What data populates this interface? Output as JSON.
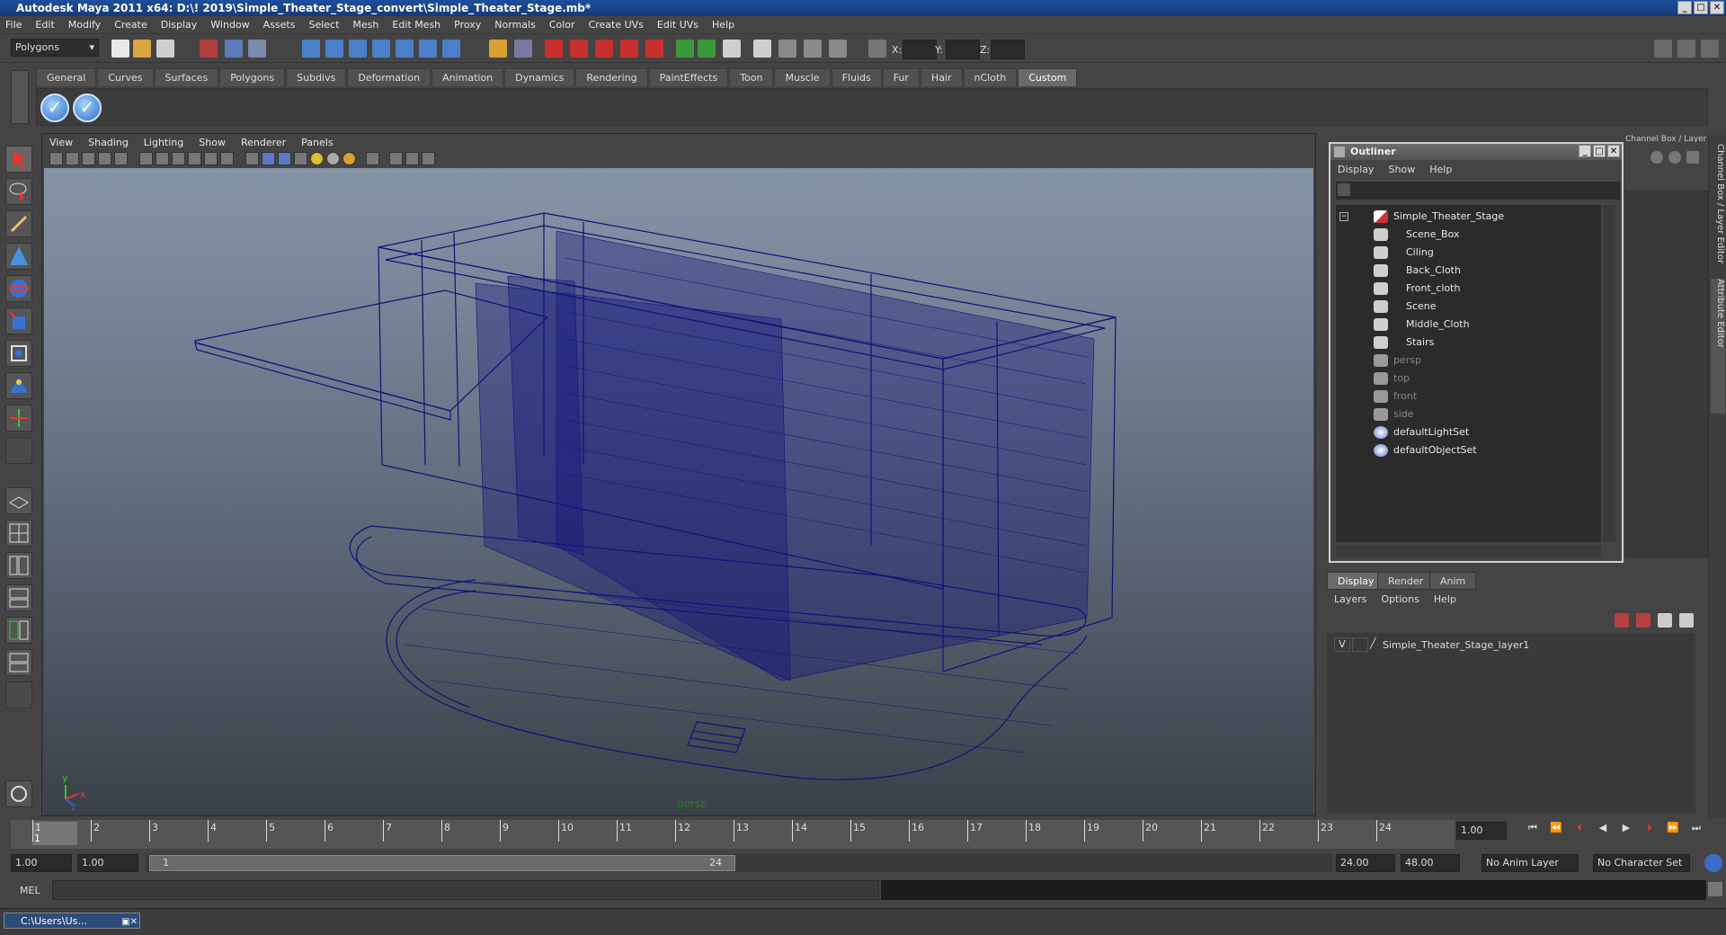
{
  "title_bar": {
    "text": "Autodesk Maya 2011 x64: D:\\! 2019\\Simple_Theater_Stage_convert\\Simple_Theater_Stage.mb*"
  },
  "menu": [
    "File",
    "Edit",
    "Modify",
    "Create",
    "Display",
    "Window",
    "Assets",
    "Select",
    "Mesh",
    "Edit Mesh",
    "Proxy",
    "Normals",
    "Color",
    "Create UVs",
    "Edit UVs",
    "Help"
  ],
  "status_line": {
    "mode": "Polygons",
    "x_label": "X:",
    "y_label": "Y:",
    "z_label": "Z:"
  },
  "shelf_tabs": [
    "General",
    "Curves",
    "Surfaces",
    "Polygons",
    "Subdivs",
    "Deformation",
    "Animation",
    "Dynamics",
    "Rendering",
    "PaintEffects",
    "Toon",
    "Muscle",
    "Fluids",
    "Fur",
    "Hair",
    "nCloth",
    "Custom"
  ],
  "shelf_active": "Custom",
  "viewport": {
    "menu": [
      "View",
      "Shading",
      "Lighting",
      "Show",
      "Renderer",
      "Panels"
    ],
    "camera_label": "persp",
    "axis": {
      "y": "y",
      "x": "x",
      "z": "z"
    },
    "wire_color": "#11117a"
  },
  "outliner": {
    "title": "Outliner",
    "menu": [
      "Display",
      "Show",
      "Help"
    ],
    "items": [
      {
        "label": "Simple_Theater_Stage",
        "level": 0,
        "kind": "group"
      },
      {
        "label": "Scene_Box",
        "level": 1,
        "kind": "mesh"
      },
      {
        "label": "Ciling",
        "level": 1,
        "kind": "mesh"
      },
      {
        "label": "Back_Cloth",
        "level": 1,
        "kind": "mesh"
      },
      {
        "label": "Front_cloth",
        "level": 1,
        "kind": "mesh"
      },
      {
        "label": "Scene",
        "level": 1,
        "kind": "mesh"
      },
      {
        "label": "Middle_Cloth",
        "level": 1,
        "kind": "mesh"
      },
      {
        "label": "Stairs",
        "level": 1,
        "kind": "mesh"
      },
      {
        "label": "persp",
        "level": 0,
        "kind": "camera"
      },
      {
        "label": "top",
        "level": 0,
        "kind": "camera"
      },
      {
        "label": "front",
        "level": 0,
        "kind": "camera"
      },
      {
        "label": "side",
        "level": 0,
        "kind": "camera"
      },
      {
        "label": "defaultLightSet",
        "level": 0,
        "kind": "set"
      },
      {
        "label": "defaultObjectSet",
        "level": 0,
        "kind": "set"
      }
    ]
  },
  "channel_box": {
    "title": "Channel Box / Layer Editor",
    "side_tabs": [
      "Channel Box / Layer Editor",
      "Attribute Editor"
    ]
  },
  "layer_editor": {
    "tabs": [
      "Display",
      "Render",
      "Anim"
    ],
    "menu": [
      "Layers",
      "Options",
      "Help"
    ],
    "layers": [
      {
        "visible": "V",
        "name": "Simple_Theater_Stage_layer1"
      }
    ]
  },
  "timeline": {
    "ticks": [
      "1",
      "2",
      "3",
      "4",
      "5",
      "6",
      "7",
      "8",
      "9",
      "10",
      "11",
      "12",
      "13",
      "14",
      "15",
      "16",
      "17",
      "18",
      "19",
      "20",
      "21",
      "22",
      "23",
      "24"
    ],
    "current_frame": "1.00",
    "current_marker": "1"
  },
  "range": {
    "start": "1.00",
    "playback_start": "1.00",
    "slider_start": "1",
    "slider_end": "24",
    "playback_end": "24.00",
    "end": "48.00",
    "anim_layer": "No Anim Layer",
    "char_set": "No Character Set"
  },
  "command_line": {
    "label": "MEL"
  },
  "taskbar": {
    "minimized": "C:\\Users\\Us..."
  }
}
